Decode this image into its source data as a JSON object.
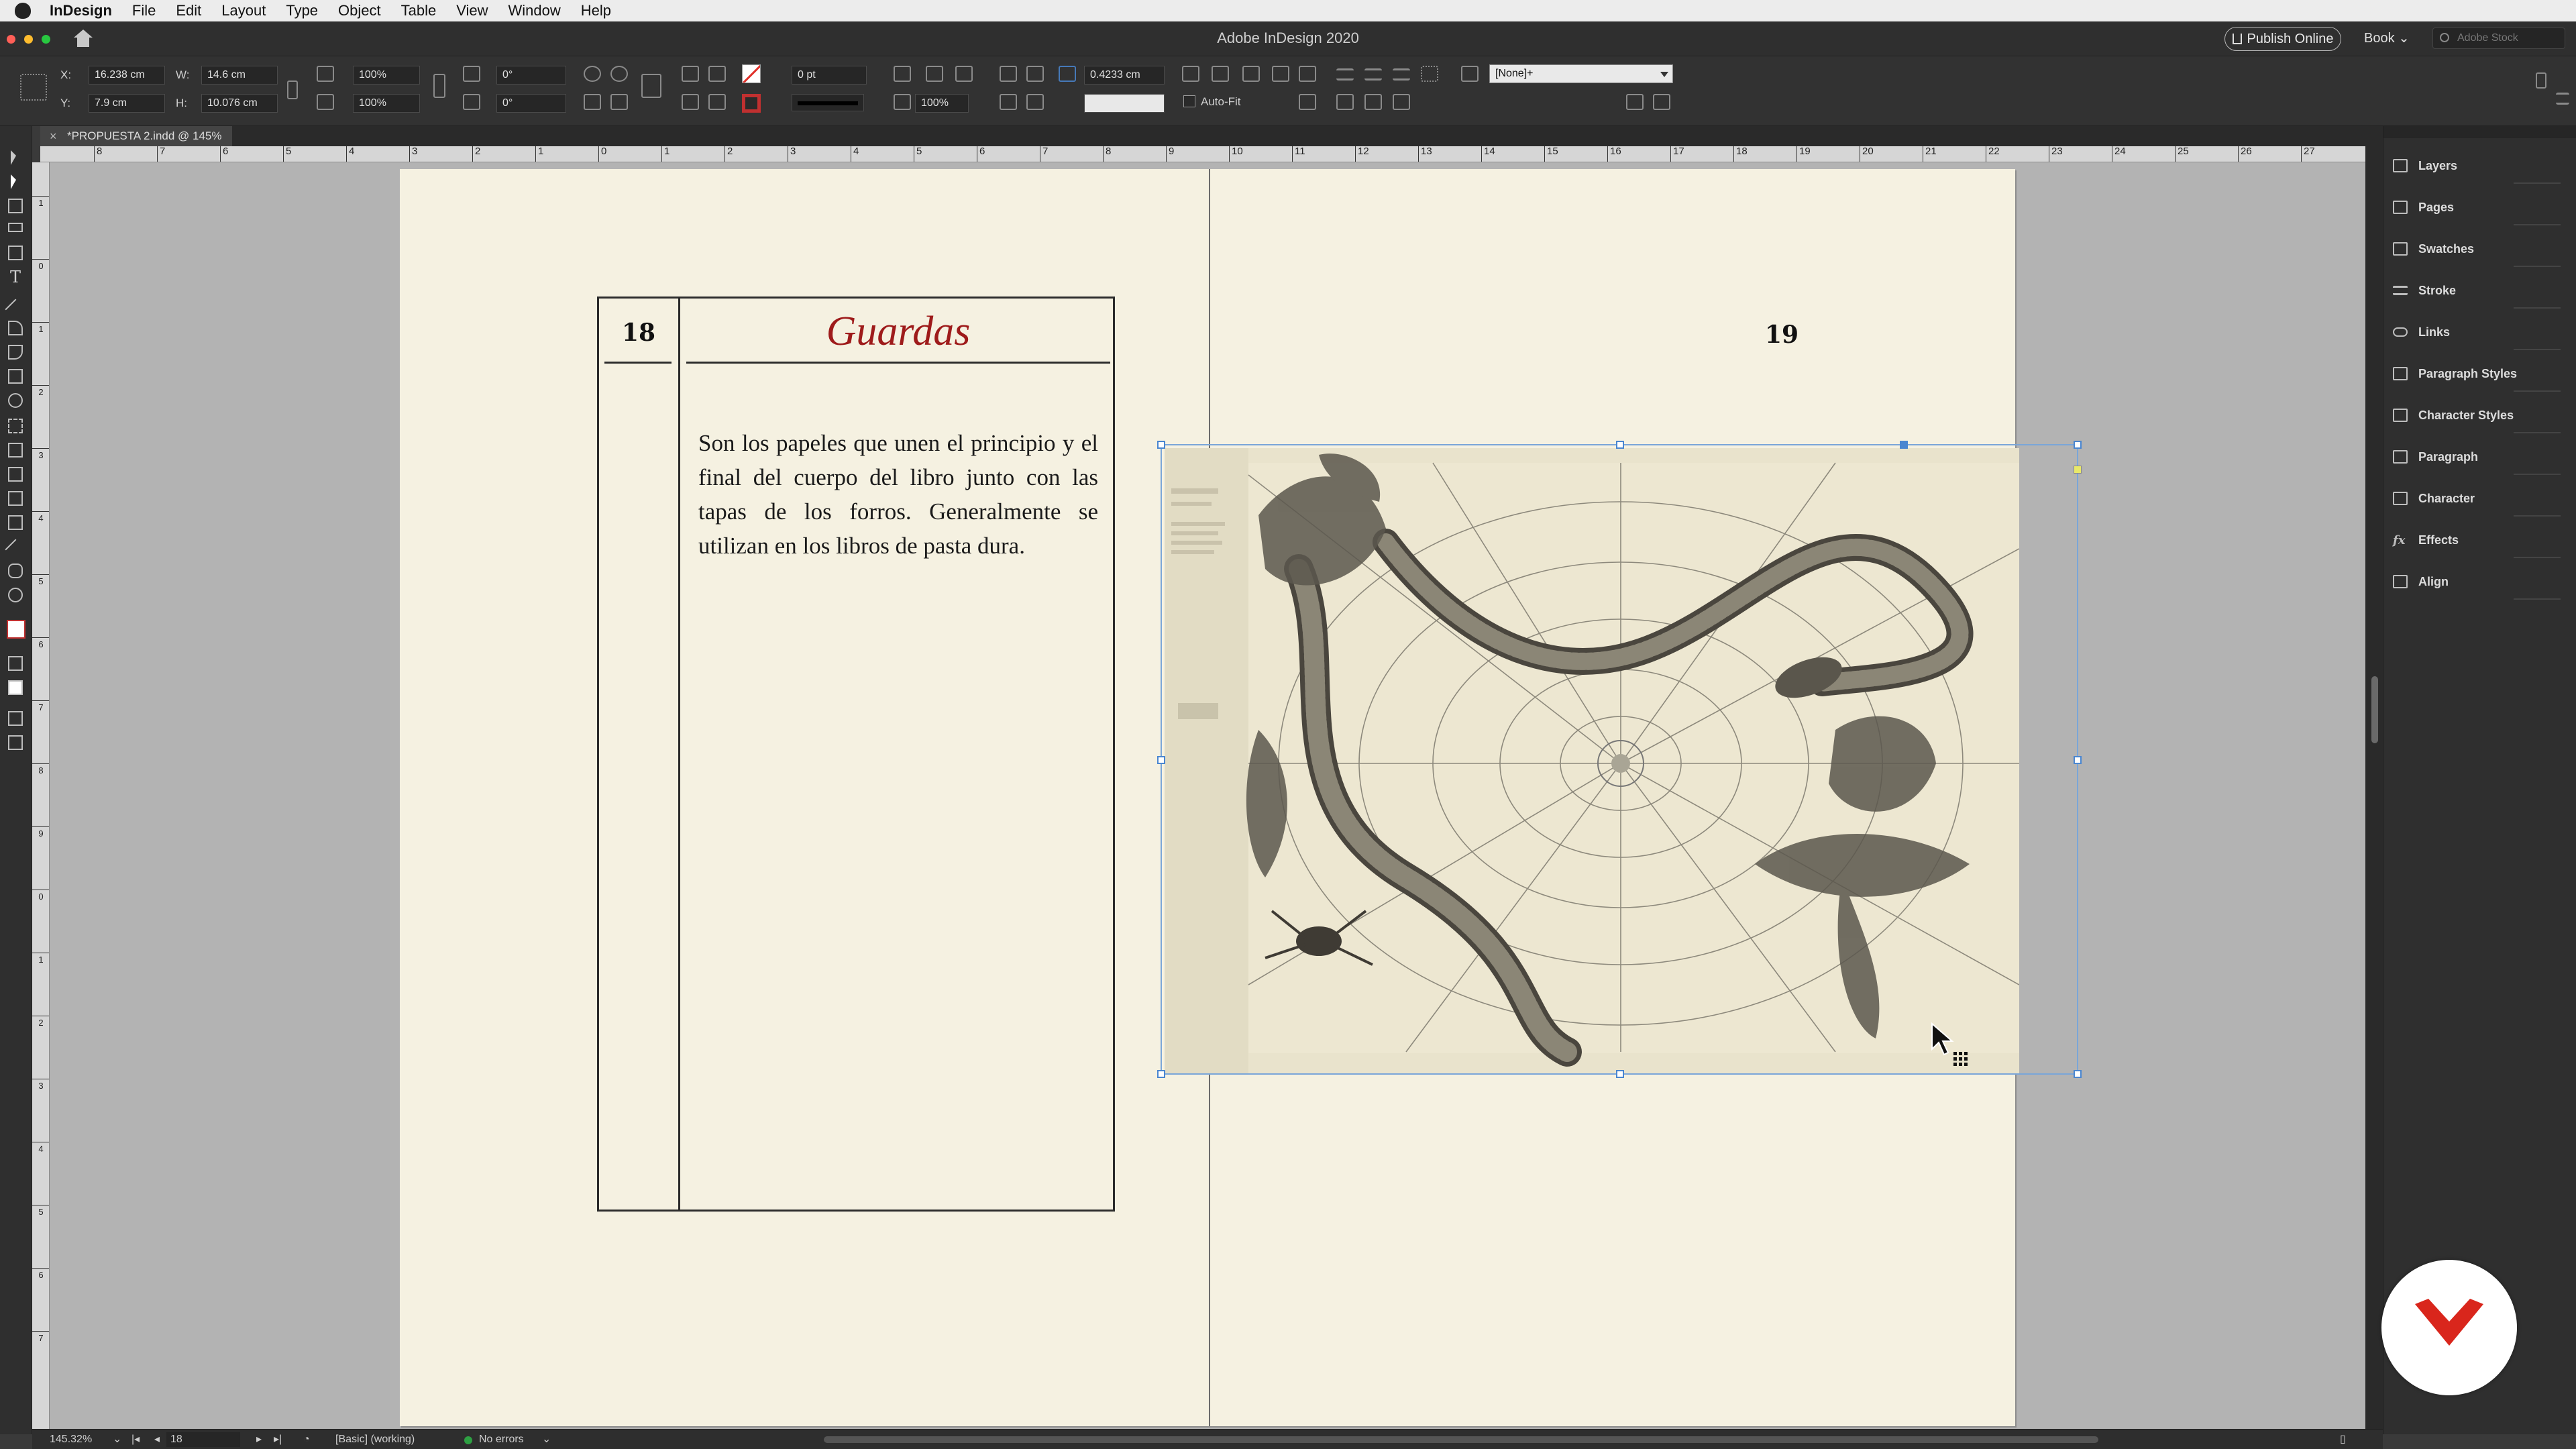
{
  "menubar": {
    "items": [
      "InDesign",
      "File",
      "Edit",
      "Layout",
      "Type",
      "Object",
      "Table",
      "View",
      "Window",
      "Help"
    ]
  },
  "titlebar": {
    "title": "Adobe InDesign 2020",
    "publish_label": "Publish Online",
    "workspace": "Book ⌄",
    "stock_placeholder": "Adobe Stock"
  },
  "control": {
    "x_label": "X:",
    "x_value": "16.238 cm",
    "y_label": "Y:",
    "y_value": "7.9 cm",
    "w_label": "W:",
    "w_value": "14.6 cm",
    "h_label": "H:",
    "h_value": "10.076 cm",
    "scale_x": "100%",
    "scale_y": "100%",
    "angle": "0°",
    "shear": "0°",
    "stroke_weight": "0 pt",
    "opacity": "100%",
    "offset": "0.4233 cm",
    "autofit_label": "Auto-Fit",
    "object_style": "[None]+"
  },
  "doc_tab": {
    "label": "*PROPUESTA 2.indd @ 145%"
  },
  "rulers": {
    "top": [
      "8",
      "7",
      "6",
      "5",
      "4",
      "3",
      "2",
      "1",
      "0",
      "1",
      "2",
      "3",
      "4",
      "5",
      "6",
      "7",
      "8",
      "9",
      "10",
      "11",
      "12",
      "13",
      "14",
      "15",
      "16",
      "17",
      "18",
      "19",
      "20",
      "21",
      "22",
      "23",
      "24",
      "25",
      "26",
      "27"
    ],
    "left": [
      "1",
      "0",
      "1",
      "2",
      "3",
      "4",
      "5",
      "6",
      "7",
      "8",
      "9",
      "0",
      "1",
      "2",
      "3",
      "4",
      "5",
      "6",
      "7"
    ]
  },
  "page": {
    "left_number": "18",
    "heading": "Guardas",
    "body": "Son los papeles que unen el principio y el final del cuerpo del libro junto con las tapas de los forros. Generalmente se utilizan en los libros de pasta dura.",
    "right_number": "19"
  },
  "panels": {
    "items": [
      "Layers",
      "Pages",
      "Swatches",
      "Stroke",
      "Links",
      "Paragraph Styles",
      "Character Styles",
      "Paragraph",
      "Character",
      "Effects",
      "Align"
    ]
  },
  "status": {
    "zoom": "145.32%",
    "page": "18",
    "preflight_profile": "[Basic] (working)",
    "errors": "No errors"
  },
  "colors": {
    "heading_red": "#9e1b1b",
    "page_paper": "#f5f1e1",
    "selection_blue": "#7aa6d8",
    "logo_red": "#d9261c"
  }
}
